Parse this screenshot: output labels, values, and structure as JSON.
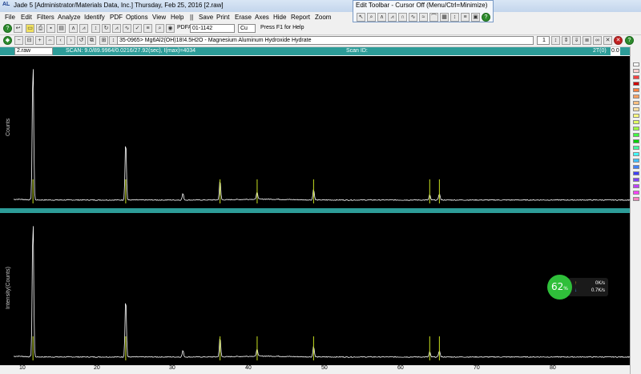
{
  "window": {
    "title": "Jade 5 [Administrator/Materials Data, Inc.] Thursday, Feb 25, 2016 [2.raw]",
    "app_icon": "jade-logo-icon",
    "app_label": "AL"
  },
  "menu": [
    "File",
    "Edit",
    "Filters",
    "Analyze",
    "Identify",
    "PDF",
    "Options",
    "View",
    "Help",
    "||",
    "Save",
    "Print",
    "Erase",
    "Axes",
    "Hide",
    "Report",
    "Zoom"
  ],
  "edit_toolbar": {
    "title": "Edit Toolbar - Cursor Off (Menu/Ctrl=Minimize)"
  },
  "toolbar1": {
    "pdf_label": "PDF#",
    "pdf_value": "01-1142",
    "element_value": "Cu",
    "help_text": "Press F1 for Help"
  },
  "toolbar2": {
    "card_value": "35-0965> Mg6Al2(OH)18!4.5H2O - Magnesium Aluminum Hydroxide Hydrate",
    "page_value": "1"
  },
  "scan_header": {
    "file": "2.raw",
    "scan_info": "SCAN: 9.0/89.9964/0.0216/27.92(sec), I(max)=4034",
    "scan_id_label": "Scan ID:",
    "axis_mode": "2T(0)",
    "axis_value": "0.0"
  },
  "plots": [
    {
      "ylabel": "Counts"
    },
    {
      "ylabel": "Intensity(Counts)"
    }
  ],
  "x_axis_ticks": [
    "10",
    "20",
    "30",
    "40",
    "50",
    "60",
    "70",
    "80"
  ],
  "chart_data": {
    "type": "line",
    "x_range": [
      9.0,
      89.9964
    ],
    "y_max": 4034,
    "peaks": [
      {
        "x": 11.4,
        "y": 4034
      },
      {
        "x": 22.9,
        "y": 1750
      },
      {
        "x": 30.0,
        "y": 190
      },
      {
        "x": 34.6,
        "y": 560
      },
      {
        "x": 39.2,
        "y": 210
      },
      {
        "x": 46.2,
        "y": 320
      },
      {
        "x": 60.6,
        "y": 150
      },
      {
        "x": 61.8,
        "y": 190
      }
    ],
    "reference_lines": [
      11.4,
      22.9,
      34.6,
      39.2,
      46.2,
      60.6,
      61.8
    ]
  },
  "speed_widget": {
    "percent": "62",
    "percent_sign": "%",
    "upload": "0K/s",
    "download": "0.7K/s"
  },
  "colors": {
    "plot_bg": "#000000",
    "header_bg": "#2d9c98",
    "trace": "#ffffff",
    "reference": "#c8e020"
  }
}
